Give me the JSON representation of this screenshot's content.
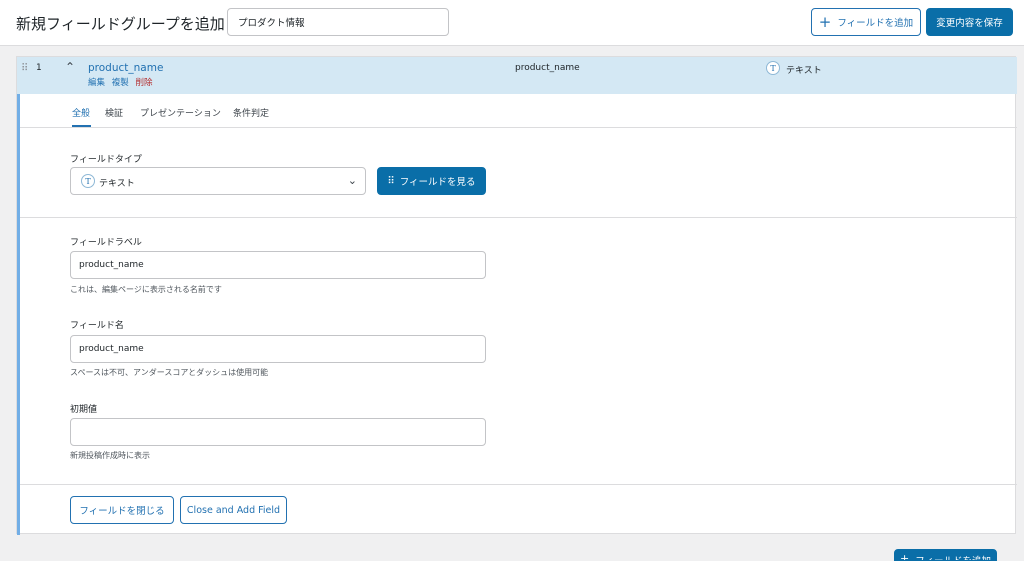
{
  "header": {
    "title": "新規フィールドグループを追加",
    "group_title_value": "プロダクト情報",
    "add_field_label": "フィールドを追加",
    "save_label": "変更内容を保存"
  },
  "field_row": {
    "order": "1",
    "label": "product_name",
    "actions": {
      "edit": "編集",
      "duplicate": "複製",
      "delete": "削除"
    },
    "name": "product_name",
    "type_icon_glyph": "T",
    "type": "テキスト"
  },
  "tabs": [
    {
      "label": "全般",
      "active": true
    },
    {
      "label": "検証",
      "active": false
    },
    {
      "label": "プレゼンテーション",
      "active": false
    },
    {
      "label": "条件判定",
      "active": false
    }
  ],
  "field_type": {
    "label": "フィールドタイプ",
    "icon_glyph": "T",
    "value": "テキスト",
    "browse_label": "フィールドを見る"
  },
  "field_label": {
    "label": "フィールドラベル",
    "value": "product_name",
    "help": "これは、編集ページに表示される名前です"
  },
  "field_name": {
    "label": "フィールド名",
    "value": "product_name",
    "help": "スペースは不可、アンダースコアとダッシュは使用可能"
  },
  "default_value": {
    "label": "初期値",
    "value": "",
    "help": "新規投稿作成時に表示"
  },
  "footer": {
    "close_label": "フィールドを閉じる",
    "close_add_label": "Close and Add Field",
    "add_field_label": "フィールドを追加"
  },
  "colors": {
    "accent": "#2271b1",
    "primary_button": "#0a6ea8",
    "row_highlight": "#d4e8f4",
    "delete": "#b32d2e"
  }
}
